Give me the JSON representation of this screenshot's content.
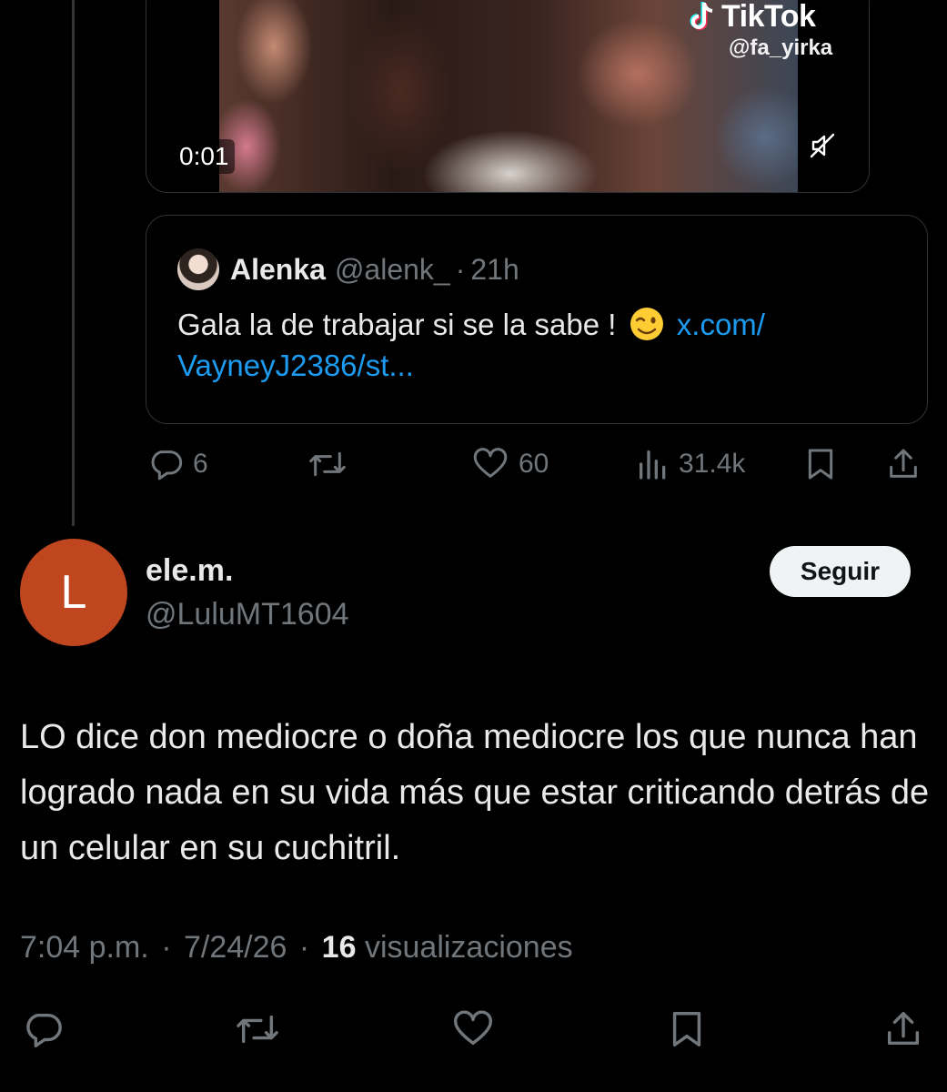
{
  "video": {
    "timestamp": "0:01",
    "watermark_brand": "TikTok",
    "watermark_user": "@fa_yirka",
    "muted": true
  },
  "quote": {
    "author_name": "Alenka",
    "author_handle": "@alenk_",
    "separator": "·",
    "time": "21h",
    "text": "Gala la de trabajar si se la sabe !",
    "emoji": "😉",
    "link_line1": "x.com/",
    "link_line2": "VayneyJ2386/st..."
  },
  "parent_actions": {
    "replies": "6",
    "retweets": "",
    "likes": "60",
    "views": "31.4k"
  },
  "reply": {
    "avatar_letter": "L",
    "avatar_color": "#c0461f",
    "name": "ele.m.",
    "handle": "@LuluMT1604",
    "follow_label": "Seguir",
    "text": "LO dice don mediocre o doña mediocre los que nunca han logrado nada en su vida más que estar criticando detrás de un celular en su cuchitril.",
    "time": "7:04 p.m.",
    "separator": "·",
    "date": "7/24/26",
    "views_count": "16",
    "views_label": "visualizaciones"
  },
  "colors": {
    "background": "#000000",
    "text_primary": "#e7e9ea",
    "text_secondary": "#71767b",
    "link": "#1d9bf0",
    "border": "#2f3336"
  },
  "icons": {
    "reply": "reply-bubble-icon",
    "retweet": "retweet-icon",
    "like": "heart-icon",
    "views": "views-bars-icon",
    "bookmark": "bookmark-icon",
    "share": "share-icon",
    "mute": "muted-speaker-icon"
  }
}
